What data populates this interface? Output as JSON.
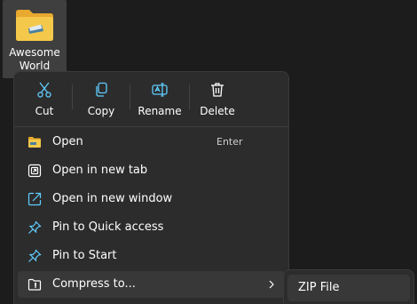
{
  "desktop": {
    "folder": {
      "label_line1": "Awesome",
      "label_line2": "World"
    }
  },
  "context_menu": {
    "toolbar": {
      "cut_label": "Cut",
      "copy_label": "Copy",
      "rename_label": "Rename",
      "delete_label": "Delete"
    },
    "items": [
      {
        "label": "Open",
        "shortcut": "Enter",
        "icon": "folder-icon"
      },
      {
        "label": "Open in new tab",
        "icon": "new-tab-icon"
      },
      {
        "label": "Open in new window",
        "icon": "new-window-icon"
      },
      {
        "label": "Pin to Quick access",
        "icon": "pin-icon"
      },
      {
        "label": "Pin to Start",
        "icon": "pin-icon"
      },
      {
        "label": "Compress to...",
        "icon": "zip-folder-icon",
        "has_submenu": true
      }
    ]
  },
  "submenu": {
    "items": [
      {
        "label": "ZIP File"
      }
    ]
  },
  "colors": {
    "background": "#1c1c1c",
    "menu_background": "#2c2c2c",
    "highlight": "#383838",
    "accent_blue": "#60cdff",
    "folder_yellow": "#f4c84a"
  }
}
